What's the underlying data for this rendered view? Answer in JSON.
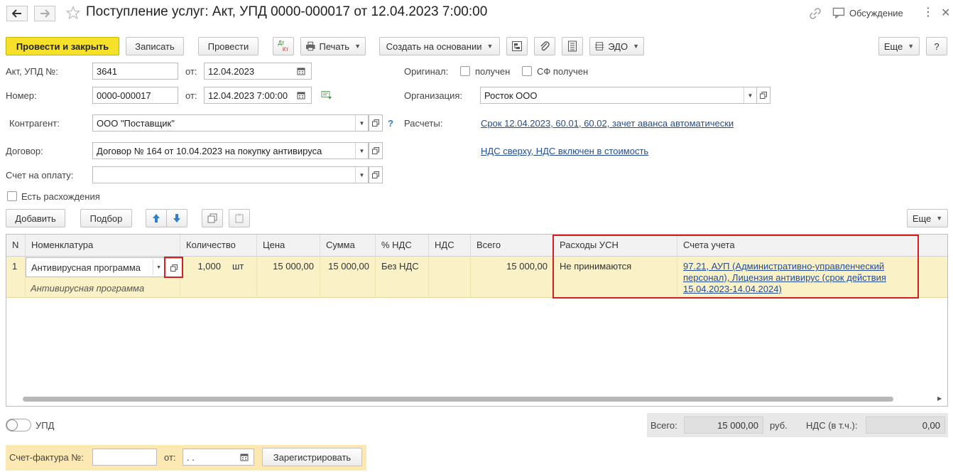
{
  "header": {
    "title": "Поступление услуг: Акт, УПД 0000-000017 от 12.04.2023 7:00:00",
    "discussion_label": "Обсуждение"
  },
  "toolbar": {
    "post_close": "Провести и закрыть",
    "save": "Записать",
    "post": "Провести",
    "dtkt_top": "Дт",
    "dtkt_bottom": "Кт",
    "print": "Печать",
    "create_based": "Создать на основании",
    "edo": "ЭДО",
    "more": "Еще",
    "help": "?"
  },
  "form": {
    "act_label": "Акт, УПД №:",
    "act_number": "3641",
    "from_label": "от:",
    "act_date": "12.04.2023",
    "number_label": "Номер:",
    "number": "0000-000017",
    "number_date": "12.04.2023  7:00:00",
    "original_label": "Оригинал:",
    "received_label": "получен",
    "sf_received_label": "СФ получен",
    "org_label": "Организация:",
    "org_value": "Росток ООО",
    "counterparty_label": "Контрагент:",
    "counterparty_value": "ООО \"Поставщик\"",
    "help_mark": "?",
    "payments_label": "Расчеты:",
    "payments_link": "Срок 12.04.2023, 60.01, 60.02, зачет аванса автоматически",
    "contract_label": "Договор:",
    "contract_value": "Договор № 164 от 10.04.2023 на покупку антивируса",
    "vat_link": "НДС сверху, НДС включен в стоимость",
    "invoice_label": "Счет на оплату:",
    "invoice_value": "",
    "discrepancy_label": "Есть расхождения"
  },
  "table_toolbar": {
    "add": "Добавить",
    "pick": "Подбор",
    "more": "Еще"
  },
  "table": {
    "columns": [
      "N",
      "Номенклатура",
      "Количество",
      "Цена",
      "Сумма",
      "% НДС",
      "НДС",
      "Всего",
      "Расходы УСН",
      "Счета учета"
    ],
    "rows": [
      {
        "n": "1",
        "item": "Антивирусная программа",
        "item_sub": "Антивирусная программа",
        "qty": "1,000",
        "unit": "шт",
        "price": "15 000,00",
        "sum": "15 000,00",
        "vat_rate": "Без НДС",
        "vat": "",
        "total": "15 000,00",
        "usn": "Не принимаются",
        "accounts_line1": "97.21, АУП (Административно-управленческий",
        "accounts_line2": "персонал), Лицензия антивирус (срок действия",
        "accounts_line3": "15.04.2023-14.04.2024)"
      }
    ]
  },
  "footer": {
    "upd_label": "УПД",
    "total_label": "Всего:",
    "total_value": "15 000,00",
    "currency": "руб.",
    "vat_incl_label": "НДС (в т.ч.):",
    "vat_incl_value": "0,00",
    "sf_label": "Счет-фактура №:",
    "sf_number": "",
    "sf_from_label": "от:",
    "sf_date": " .  .",
    "register_button": "Зарегистрировать"
  },
  "colors": {
    "accent_yellow": "#f6e12a",
    "row_highlight": "#fbf1c7",
    "link_blue": "#254d95",
    "highlight_red": "#d42020"
  }
}
